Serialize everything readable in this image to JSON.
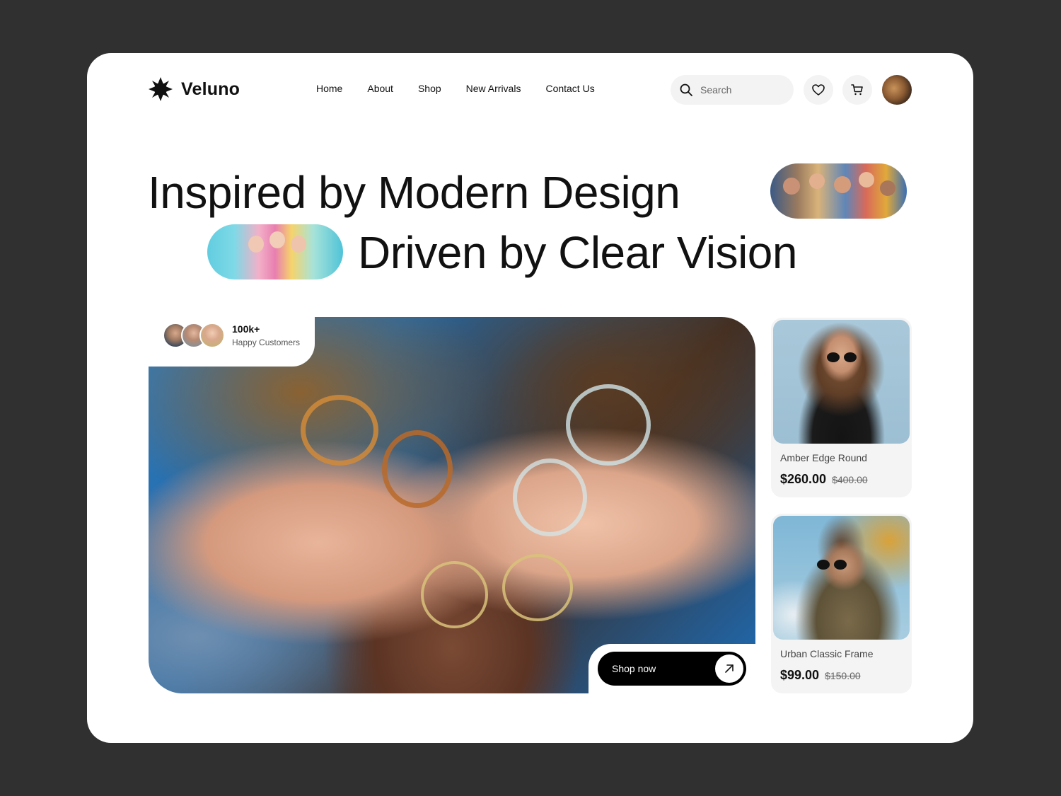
{
  "brand": {
    "name": "Veluno"
  },
  "nav": {
    "items": [
      {
        "label": "Home"
      },
      {
        "label": "About"
      },
      {
        "label": "Shop"
      },
      {
        "label": "New Arrivals"
      },
      {
        "label": "Contact Us"
      }
    ]
  },
  "search": {
    "placeholder": "Search"
  },
  "icons": {
    "search": "search-icon",
    "wishlist": "heart-icon",
    "cart": "cart-icon",
    "shop_arrow": "arrow-up-right-icon"
  },
  "hero": {
    "line1": "Inspired by Modern Design",
    "line2": "Driven by Clear Vision"
  },
  "customers": {
    "count": "100k+",
    "label": "Happy Customers"
  },
  "cta": {
    "label": "Shop now"
  },
  "products": [
    {
      "name": "Amber Edge Round",
      "price": "$260.00",
      "old_price": "$400.00"
    },
    {
      "name": "Urban Classic Frame",
      "price": "$99.00",
      "old_price": "$150.00"
    }
  ],
  "colors": {
    "background": "#303030",
    "card": "#ffffff",
    "text": "#111111",
    "accent": "#000000",
    "muted": "#f4f4f4"
  }
}
